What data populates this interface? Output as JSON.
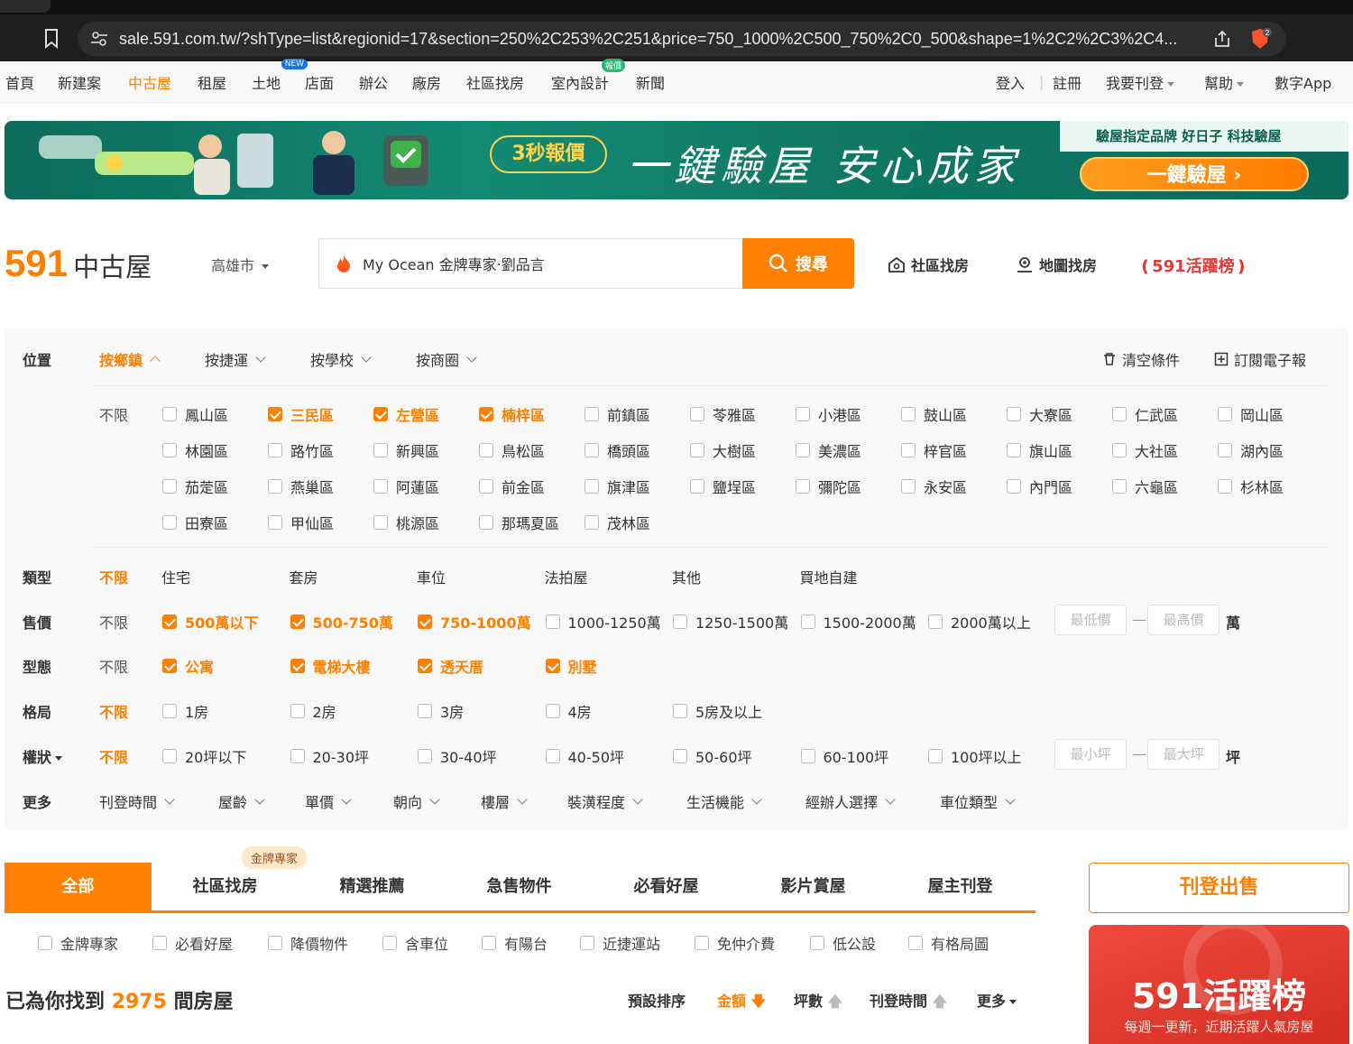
{
  "browser": {
    "url": "sale.591.com.tw/?shType=list&regionid=17&section=250%2C253%2C251&price=750_1000%2C500_750%2C0_500&shape=1%2C2%2C3%2C4...",
    "brave_count": "2"
  },
  "topnav": {
    "items": [
      "首頁",
      "新建案",
      "中古屋",
      "租屋",
      "土地",
      "店面",
      "辦公",
      "廠房",
      "社區找房",
      "室內設計",
      "新聞"
    ],
    "badge_new": "NEW",
    "badge_hot": "報價",
    "login": "登入",
    "register": "註冊",
    "post": "我要刊登",
    "help": "幫助",
    "app": "數字App"
  },
  "banner": {
    "pill": "3秒報價",
    "slogan": "一鍵驗屋 安心成家",
    "brand": "驗屋指定品牌 好日子 科技驗屋",
    "cta": "一鍵驗屋 ›"
  },
  "header": {
    "logo_num": "591",
    "logo_text": "中古屋",
    "city": "高雄市",
    "search_value": "My Ocean 金牌專家‧劉品言",
    "search_button": "搜尋",
    "community": "社區找房",
    "map": "地圖找房",
    "hot_rank": "❪591活躍榜❫"
  },
  "filters": {
    "location_label": "位置",
    "location_tabs": [
      "按鄉鎮",
      "按捷運",
      "按學校",
      "按商圈"
    ],
    "clear": "清空條件",
    "subscribe": "訂閱電子報",
    "unlimited": "不限",
    "districts": [
      {
        "name": "鳳山區",
        "checked": false
      },
      {
        "name": "三民區",
        "checked": true
      },
      {
        "name": "左營區",
        "checked": true
      },
      {
        "name": "楠梓區",
        "checked": true
      },
      {
        "name": "前鎮區",
        "checked": false
      },
      {
        "name": "苓雅區",
        "checked": false
      },
      {
        "name": "小港區",
        "checked": false
      },
      {
        "name": "鼓山區",
        "checked": false
      },
      {
        "name": "大寮區",
        "checked": false
      },
      {
        "name": "仁武區",
        "checked": false
      },
      {
        "name": "岡山區",
        "checked": false
      },
      {
        "name": "林園區",
        "checked": false
      },
      {
        "name": "路竹區",
        "checked": false
      },
      {
        "name": "新興區",
        "checked": false
      },
      {
        "name": "鳥松區",
        "checked": false
      },
      {
        "name": "橋頭區",
        "checked": false
      },
      {
        "name": "大樹區",
        "checked": false
      },
      {
        "name": "美濃區",
        "checked": false
      },
      {
        "name": "梓官區",
        "checked": false
      },
      {
        "name": "旗山區",
        "checked": false
      },
      {
        "name": "大社區",
        "checked": false
      },
      {
        "name": "湖內區",
        "checked": false
      },
      {
        "name": "茄萣區",
        "checked": false
      },
      {
        "name": "燕巢區",
        "checked": false
      },
      {
        "name": "阿蓮區",
        "checked": false
      },
      {
        "name": "前金區",
        "checked": false
      },
      {
        "name": "旗津區",
        "checked": false
      },
      {
        "name": "鹽埕區",
        "checked": false
      },
      {
        "name": "彌陀區",
        "checked": false
      },
      {
        "name": "永安區",
        "checked": false
      },
      {
        "name": "內門區",
        "checked": false
      },
      {
        "name": "六龜區",
        "checked": false
      },
      {
        "name": "杉林區",
        "checked": false
      },
      {
        "name": "田寮區",
        "checked": false
      },
      {
        "name": "甲仙區",
        "checked": false
      },
      {
        "name": "桃源區",
        "checked": false
      },
      {
        "name": "那瑪夏區",
        "checked": false
      },
      {
        "name": "茂林區",
        "checked": false
      }
    ],
    "type_label": "類型",
    "types": [
      "住宅",
      "套房",
      "車位",
      "法拍屋",
      "其他",
      "買地自建"
    ],
    "price_label": "售價",
    "prices": [
      {
        "name": "500萬以下",
        "checked": true
      },
      {
        "name": "500-750萬",
        "checked": true
      },
      {
        "name": "750-1000萬",
        "checked": true
      },
      {
        "name": "1000-1250萬",
        "checked": false
      },
      {
        "name": "1250-1500萬",
        "checked": false
      },
      {
        "name": "1500-2000萬",
        "checked": false
      },
      {
        "name": "2000萬以上",
        "checked": false
      }
    ],
    "price_min": "最低價",
    "price_max": "最高價",
    "price_unit": "萬",
    "shape_label": "型態",
    "shapes": [
      {
        "name": "公寓",
        "checked": true
      },
      {
        "name": "電梯大樓",
        "checked": true
      },
      {
        "name": "透天厝",
        "checked": true
      },
      {
        "name": "別墅",
        "checked": true
      }
    ],
    "layout_label": "格局",
    "layouts": [
      "1房",
      "2房",
      "3房",
      "4房",
      "5房及以上"
    ],
    "area_label": "權狀",
    "areas": [
      "20坪以下",
      "20-30坪",
      "30-40坪",
      "40-50坪",
      "50-60坪",
      "60-100坪",
      "100坪以上"
    ],
    "area_min": "最小坪",
    "area_max": "最大坪",
    "area_unit": "坪",
    "more_label": "更多",
    "more": [
      "刊登時間",
      "屋齡",
      "單價",
      "朝向",
      "樓層",
      "裝潢程度",
      "生活機能",
      "經辦人選擇",
      "車位類型"
    ]
  },
  "tabs": {
    "items": [
      "全部",
      "社區找房",
      "精選推薦",
      "急售物件",
      "必看好屋",
      "影片賞屋",
      "屋主刊登"
    ],
    "badge": "金牌專家"
  },
  "checks": [
    "金牌專家",
    "必看好屋",
    "降價物件",
    "含車位",
    "有陽台",
    "近捷運站",
    "免仲介費",
    "低公設",
    "有格局圖"
  ],
  "results": {
    "prefix": "已為你找到",
    "count": "2975",
    "suffix": "間房屋"
  },
  "sort": {
    "default": "預設排序",
    "price": "金額",
    "area": "坪數",
    "time": "刊登時間",
    "more": "更多"
  },
  "side": {
    "post": "刊登出售",
    "rank_title": "591活躍榜",
    "rank_sub": "每週一更新，近期活躍人氣房屋"
  },
  "colors": {
    "accent": "#ff8000",
    "banner": "#0f7a66",
    "rank": "#e53935"
  }
}
